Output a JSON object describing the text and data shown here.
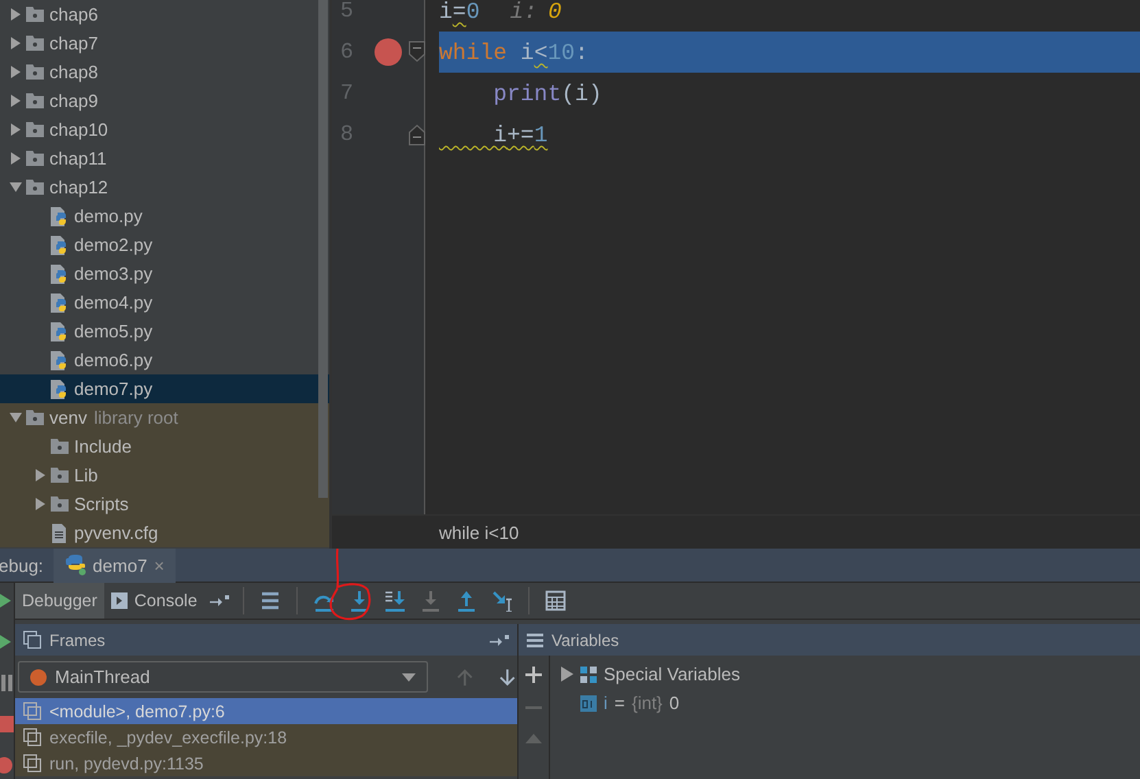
{
  "project_tree": {
    "items": [
      {
        "name": "chap6",
        "kind": "folder",
        "expanded": false,
        "selected": false,
        "library": false
      },
      {
        "name": "chap7",
        "kind": "folder",
        "expanded": false,
        "selected": false,
        "library": false
      },
      {
        "name": "chap8",
        "kind": "folder",
        "expanded": false,
        "selected": false,
        "library": false
      },
      {
        "name": "chap9",
        "kind": "folder",
        "expanded": false,
        "selected": false,
        "library": false
      },
      {
        "name": "chap10",
        "kind": "folder",
        "expanded": false,
        "selected": false,
        "library": false
      },
      {
        "name": "chap11",
        "kind": "folder",
        "expanded": false,
        "selected": false,
        "library": false
      },
      {
        "name": "chap12",
        "kind": "folder",
        "expanded": true,
        "selected": false,
        "library": false,
        "children": [
          {
            "name": "demo.py",
            "kind": "python-file",
            "selected": false
          },
          {
            "name": "demo2.py",
            "kind": "python-file",
            "selected": false
          },
          {
            "name": "demo3.py",
            "kind": "python-file",
            "selected": false
          },
          {
            "name": "demo4.py",
            "kind": "python-file",
            "selected": false
          },
          {
            "name": "demo5.py",
            "kind": "python-file",
            "selected": false
          },
          {
            "name": "demo6.py",
            "kind": "python-file",
            "selected": false
          },
          {
            "name": "demo7.py",
            "kind": "python-file",
            "selected": true
          }
        ]
      },
      {
        "name": "venv",
        "hint": "library root",
        "kind": "folder",
        "expanded": true,
        "selected": false,
        "library": true,
        "children": [
          {
            "name": "Include",
            "kind": "folder",
            "selected": false
          },
          {
            "name": "Lib",
            "kind": "folder",
            "expanded": false,
            "selected": false
          },
          {
            "name": "Scripts",
            "kind": "folder",
            "expanded": false,
            "selected": false
          },
          {
            "name": "pyvenv.cfg",
            "kind": "text-file",
            "selected": false
          }
        ]
      }
    ]
  },
  "editor": {
    "lines": [
      {
        "number": "5",
        "breakpoint": false,
        "current": false,
        "fold_open": false,
        "fold_close": false,
        "warning": false,
        "tokens": [
          {
            "text": "i",
            "kind": "name",
            "warning": false
          },
          {
            "text": "=",
            "kind": "op",
            "warning": true
          },
          {
            "text": "0",
            "kind": "number",
            "warning": false
          }
        ],
        "inline_value": {
          "name": "i:",
          "value": "0"
        }
      },
      {
        "number": "6",
        "breakpoint": true,
        "current": true,
        "fold_open": true,
        "fold_close": false,
        "warning": false,
        "tokens": [
          {
            "text": "while ",
            "kind": "keyword",
            "warning": false
          },
          {
            "text": "i",
            "kind": "name",
            "warning": false
          },
          {
            "text": "<",
            "kind": "op",
            "warning": true
          },
          {
            "text": "10",
            "kind": "number",
            "warning": false
          },
          {
            "text": ":",
            "kind": "plain",
            "warning": false
          }
        ]
      },
      {
        "number": "7",
        "breakpoint": false,
        "current": false,
        "fold_open": false,
        "fold_close": false,
        "warning": false,
        "tokens": [
          {
            "text": "    print",
            "kind": "builtin",
            "warning": false
          },
          {
            "text": "(",
            "kind": "plain",
            "warning": false
          },
          {
            "text": "i",
            "kind": "name",
            "warning": false
          },
          {
            "text": ")",
            "kind": "plain",
            "warning": false
          }
        ]
      },
      {
        "number": "8",
        "breakpoint": false,
        "current": false,
        "fold_open": false,
        "fold_close": true,
        "warning": true,
        "tokens": [
          {
            "text": "    i",
            "kind": "name",
            "warning": false
          },
          {
            "text": "+=",
            "kind": "op",
            "warning": false
          },
          {
            "text": "1",
            "kind": "number",
            "warning": false
          }
        ]
      }
    ],
    "breadcrumb": "while i<10"
  },
  "debug": {
    "label": "ebug:",
    "session_tabs": [
      {
        "label": "demo7",
        "selected": true,
        "close": "×"
      }
    ],
    "view_tabs": [
      {
        "label": "Debugger",
        "kind": "debugger",
        "selected": true
      },
      {
        "label": "Console",
        "kind": "console",
        "selected": false
      }
    ],
    "tools": [
      {
        "kind": "frames-menu",
        "disabled": false,
        "circled": false
      },
      {
        "kind": "step-over",
        "disabled": false,
        "circled": false
      },
      {
        "kind": "step-into",
        "disabled": false,
        "circled": true
      },
      {
        "kind": "step-into-my-code",
        "disabled": false,
        "circled": false
      },
      {
        "kind": "force-step-into",
        "disabled": true,
        "circled": false
      },
      {
        "kind": "step-out",
        "disabled": false,
        "circled": false
      },
      {
        "kind": "run-to-cursor",
        "disabled": false,
        "circled": false
      },
      {
        "kind": "evaluate",
        "disabled": false,
        "circled": false
      }
    ],
    "frames": {
      "title": "Frames",
      "thread": {
        "name": "MainThread",
        "color": "#cc5f2d"
      },
      "rows": [
        {
          "label": "<module>, demo7.py:6",
          "selected": true
        },
        {
          "label": "execfile, _pydev_execfile.py:18",
          "selected": false
        },
        {
          "label": "run, pydevd.py:1135",
          "selected": false
        }
      ]
    },
    "variables": {
      "title": "Variables",
      "items": [
        {
          "kind": "group",
          "name": "Special Variables",
          "expanded": false
        },
        {
          "kind": "int",
          "name": "i",
          "op": "=",
          "type": "{int}",
          "value": "0"
        }
      ]
    }
  }
}
